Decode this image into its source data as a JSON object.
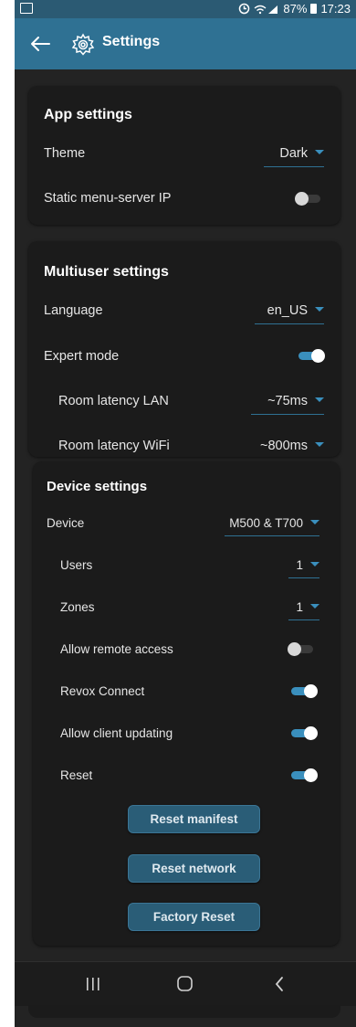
{
  "status_bar": {
    "battery_percent": "87%",
    "time": "17:23"
  },
  "app_bar": {
    "title": "Settings"
  },
  "app_settings": {
    "title": "App settings",
    "theme_label": "Theme",
    "theme_value": "Dark",
    "static_ip_label": "Static menu-server IP",
    "static_ip_enabled": false
  },
  "multiuser_settings": {
    "title": "Multiuser settings",
    "language_label": "Language",
    "language_value": "en_US",
    "expert_mode_label": "Expert mode",
    "expert_mode_enabled": true,
    "latency_lan_label": "Room latency LAN",
    "latency_lan_value": "~75ms",
    "latency_wifi_label": "Room latency WiFi",
    "latency_wifi_value": "~800ms"
  },
  "device_settings": {
    "title": "Device settings",
    "device_label": "Device",
    "device_value": "M500 & T700",
    "users_label": "Users",
    "users_value": "1",
    "zones_label": "Zones",
    "zones_value": "1",
    "remote_access_label": "Allow remote access",
    "remote_access_enabled": false,
    "revox_connect_label": "Revox Connect",
    "revox_connect_enabled": true,
    "client_updating_label": "Allow client updating",
    "client_updating_enabled": true,
    "reset_label": "Reset",
    "reset_enabled": true,
    "reset_manifest_button": "Reset manifest",
    "reset_network_button": "Reset network",
    "factory_reset_button": "Factory Reset"
  },
  "colors": {
    "accent": "#2f7193",
    "toggle_on": "#3a8fbd",
    "card_bg": "#1b1b1b",
    "page_bg": "#232323"
  }
}
